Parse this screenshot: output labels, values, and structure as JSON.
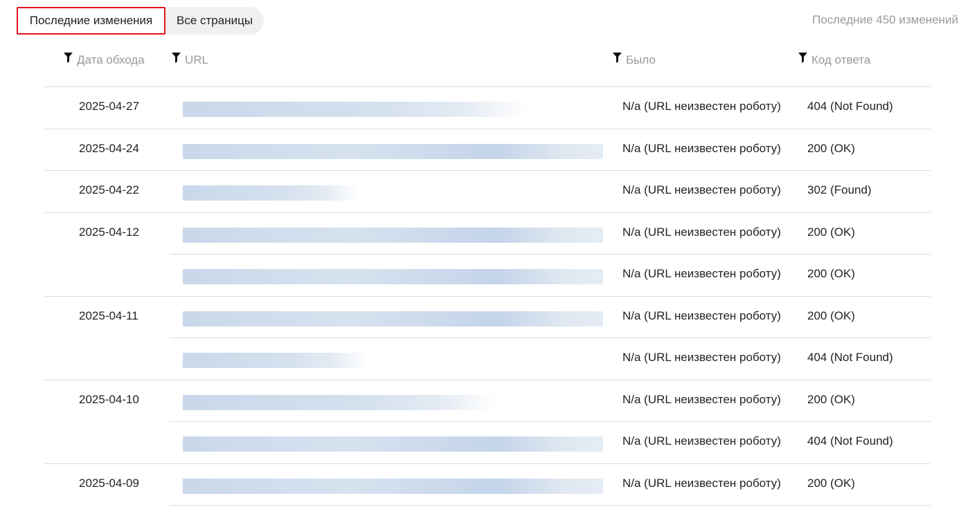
{
  "tabs": [
    {
      "label": "Последние изменения",
      "active": true
    },
    {
      "label": "Все страницы",
      "active": false
    }
  ],
  "summary": "Последние 450 изменений",
  "columns": {
    "date": "Дата обхода",
    "url": "URL",
    "prev": "Было",
    "code": "Код ответа"
  },
  "icons": {
    "filter": "filter-funnel-icon"
  },
  "colors": {
    "active_tab_border": "#e0141e",
    "url_blur": "#c6d6ea",
    "muted_text": "#999999"
  },
  "rows": [
    {
      "date": "2025-04-27",
      "prev": "N/a (URL неизвестен роботу)",
      "code": "404 (Not Found)",
      "url_fill": 0.82
    },
    {
      "date": "2025-04-24",
      "prev": "N/a (URL неизвестен роботу)",
      "code": "200 (OK)",
      "url_fill": 1.0
    },
    {
      "date": "2025-04-22",
      "prev": "N/a (URL неизвестен роботу)",
      "code": "302 (Found)",
      "url_fill": 0.42
    },
    {
      "date": "2025-04-12",
      "prev": "N/a (URL неизвестен роботу)",
      "code": "200 (OK)",
      "url_fill": 1.0
    },
    {
      "date": "",
      "prev": "N/a (URL неизвестен роботу)",
      "code": "200 (OK)",
      "url_fill": 1.0
    },
    {
      "date": "2025-04-11",
      "prev": "N/a (URL неизвестен роботу)",
      "code": "200 (OK)",
      "url_fill": 1.0
    },
    {
      "date": "",
      "prev": "N/a (URL неизвестен роботу)",
      "code": "404 (Not Found)",
      "url_fill": 0.44
    },
    {
      "date": "2025-04-10",
      "prev": "N/a (URL неизвестен роботу)",
      "code": "200 (OK)",
      "url_fill": 0.75
    },
    {
      "date": "",
      "prev": "N/a (URL неизвестен роботу)",
      "code": "404 (Not Found)",
      "url_fill": 1.0
    },
    {
      "date": "2025-04-09",
      "prev": "N/a (URL неизвестен роботу)",
      "code": "200 (OK)",
      "url_fill": 1.0
    }
  ]
}
